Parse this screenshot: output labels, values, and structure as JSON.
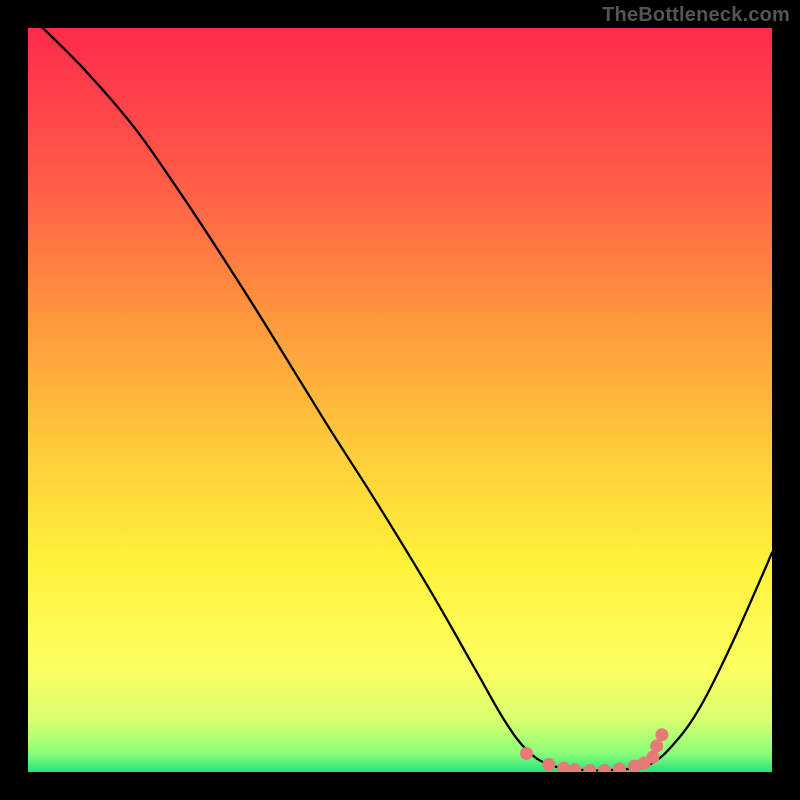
{
  "watermark": "TheBottleneck.com",
  "gradient": {
    "stops": [
      {
        "offset": 0.0,
        "color": "#ff2a4a"
      },
      {
        "offset": 0.2,
        "color": "#ff5a48"
      },
      {
        "offset": 0.4,
        "color": "#ff9a3c"
      },
      {
        "offset": 0.58,
        "color": "#ffcf3a"
      },
      {
        "offset": 0.72,
        "color": "#fff23a"
      },
      {
        "offset": 0.86,
        "color": "#fcff60"
      },
      {
        "offset": 0.93,
        "color": "#d8ff70"
      },
      {
        "offset": 0.975,
        "color": "#8bff7a"
      },
      {
        "offset": 1.0,
        "color": "#27e37a"
      }
    ]
  },
  "curve": {
    "stroke": "#000000",
    "width": 2.3,
    "points": [
      {
        "x": 0.02,
        "y": 1.0
      },
      {
        "x": 0.075,
        "y": 0.945
      },
      {
        "x": 0.14,
        "y": 0.87
      },
      {
        "x": 0.19,
        "y": 0.8
      },
      {
        "x": 0.25,
        "y": 0.71
      },
      {
        "x": 0.32,
        "y": 0.6
      },
      {
        "x": 0.4,
        "y": 0.47
      },
      {
        "x": 0.47,
        "y": 0.36
      },
      {
        "x": 0.54,
        "y": 0.245
      },
      {
        "x": 0.6,
        "y": 0.14
      },
      {
        "x": 0.64,
        "y": 0.07
      },
      {
        "x": 0.67,
        "y": 0.03
      },
      {
        "x": 0.7,
        "y": 0.01
      },
      {
        "x": 0.74,
        "y": 0.003
      },
      {
        "x": 0.79,
        "y": 0.003
      },
      {
        "x": 0.835,
        "y": 0.01
      },
      {
        "x": 0.87,
        "y": 0.04
      },
      {
        "x": 0.905,
        "y": 0.09
      },
      {
        "x": 0.945,
        "y": 0.17
      },
      {
        "x": 0.985,
        "y": 0.26
      },
      {
        "x": 1.0,
        "y": 0.295
      }
    ]
  },
  "markers": {
    "fill": "#e77a77",
    "radius": 6.5,
    "points": [
      {
        "x": 0.67,
        "y": 0.025
      },
      {
        "x": 0.7,
        "y": 0.01
      },
      {
        "x": 0.72,
        "y": 0.005
      },
      {
        "x": 0.735,
        "y": 0.003
      },
      {
        "x": 0.755,
        "y": 0.002
      },
      {
        "x": 0.775,
        "y": 0.002
      },
      {
        "x": 0.795,
        "y": 0.004
      },
      {
        "x": 0.815,
        "y": 0.008
      },
      {
        "x": 0.828,
        "y": 0.012
      },
      {
        "x": 0.84,
        "y": 0.02
      },
      {
        "x": 0.845,
        "y": 0.035
      },
      {
        "x": 0.852,
        "y": 0.05
      }
    ]
  },
  "chart_data": {
    "type": "line",
    "title": "",
    "xlabel": "",
    "ylabel": "",
    "xlim": [
      0,
      1
    ],
    "ylim": [
      0,
      1
    ],
    "series": [
      {
        "name": "bottleneck-curve",
        "x": [
          0.02,
          0.075,
          0.14,
          0.19,
          0.25,
          0.32,
          0.4,
          0.47,
          0.54,
          0.6,
          0.64,
          0.67,
          0.7,
          0.74,
          0.79,
          0.835,
          0.87,
          0.905,
          0.945,
          0.985,
          1.0
        ],
        "y": [
          1.0,
          0.945,
          0.87,
          0.8,
          0.71,
          0.6,
          0.47,
          0.36,
          0.245,
          0.14,
          0.07,
          0.03,
          0.01,
          0.003,
          0.003,
          0.01,
          0.04,
          0.09,
          0.17,
          0.26,
          0.295
        ]
      },
      {
        "name": "optimal-markers",
        "x": [
          0.67,
          0.7,
          0.72,
          0.735,
          0.755,
          0.775,
          0.795,
          0.815,
          0.828,
          0.84,
          0.845,
          0.852
        ],
        "y": [
          0.025,
          0.01,
          0.005,
          0.003,
          0.002,
          0.002,
          0.004,
          0.008,
          0.012,
          0.02,
          0.035,
          0.05
        ]
      }
    ],
    "background_gradient": [
      "#ff2a4a",
      "#ff5a48",
      "#ff9a3c",
      "#ffcf3a",
      "#fff23a",
      "#fcff60",
      "#d8ff70",
      "#8bff7a",
      "#27e37a"
    ],
    "annotations": [
      {
        "text": "TheBottleneck.com",
        "position": "top-right"
      }
    ]
  }
}
